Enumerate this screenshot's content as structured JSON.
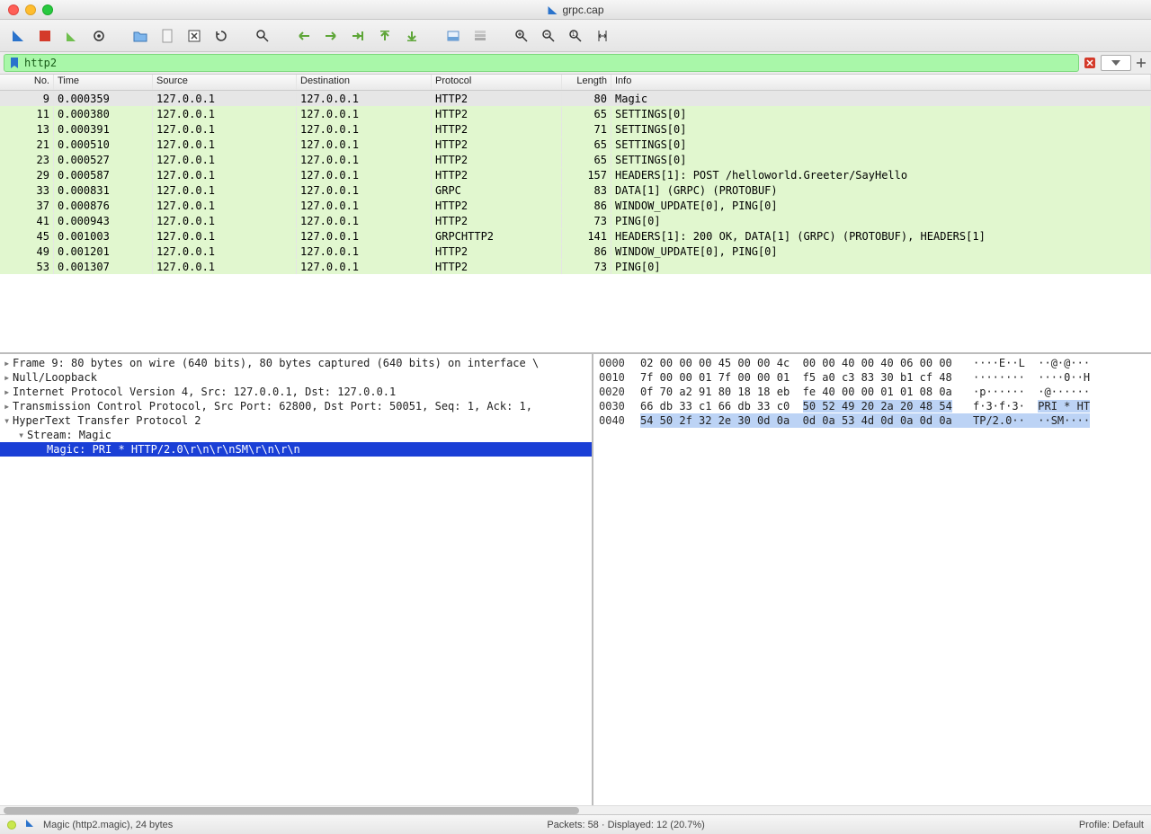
{
  "title": "grpc.cap",
  "filter": "http2",
  "columns": [
    "No.",
    "Time",
    "Source",
    "Destination",
    "Protocol",
    "Length",
    "Info"
  ],
  "packets": [
    {
      "no": "9",
      "time": "0.000359",
      "src": "127.0.0.1",
      "dst": "127.0.0.1",
      "proto": "HTTP2",
      "len": "80",
      "info": "Magic",
      "sel": true
    },
    {
      "no": "11",
      "time": "0.000380",
      "src": "127.0.0.1",
      "dst": "127.0.0.1",
      "proto": "HTTP2",
      "len": "65",
      "info": "SETTINGS[0]"
    },
    {
      "no": "13",
      "time": "0.000391",
      "src": "127.0.0.1",
      "dst": "127.0.0.1",
      "proto": "HTTP2",
      "len": "71",
      "info": "SETTINGS[0]"
    },
    {
      "no": "21",
      "time": "0.000510",
      "src": "127.0.0.1",
      "dst": "127.0.0.1",
      "proto": "HTTP2",
      "len": "65",
      "info": "SETTINGS[0]"
    },
    {
      "no": "23",
      "time": "0.000527",
      "src": "127.0.0.1",
      "dst": "127.0.0.1",
      "proto": "HTTP2",
      "len": "65",
      "info": "SETTINGS[0]"
    },
    {
      "no": "29",
      "time": "0.000587",
      "src": "127.0.0.1",
      "dst": "127.0.0.1",
      "proto": "HTTP2",
      "len": "157",
      "info": "HEADERS[1]: POST /helloworld.Greeter/SayHello"
    },
    {
      "no": "33",
      "time": "0.000831",
      "src": "127.0.0.1",
      "dst": "127.0.0.1",
      "proto": "GRPC",
      "len": "83",
      "info": "DATA[1] (GRPC) (PROTOBUF)"
    },
    {
      "no": "37",
      "time": "0.000876",
      "src": "127.0.0.1",
      "dst": "127.0.0.1",
      "proto": "HTTP2",
      "len": "86",
      "info": "WINDOW_UPDATE[0], PING[0]"
    },
    {
      "no": "41",
      "time": "0.000943",
      "src": "127.0.0.1",
      "dst": "127.0.0.1",
      "proto": "HTTP2",
      "len": "73",
      "info": "PING[0]"
    },
    {
      "no": "45",
      "time": "0.001003",
      "src": "127.0.0.1",
      "dst": "127.0.0.1",
      "proto": "GRPCHTTP2",
      "len": "141",
      "info": "HEADERS[1]: 200 OK, DATA[1] (GRPC) (PROTOBUF), HEADERS[1]"
    },
    {
      "no": "49",
      "time": "0.001201",
      "src": "127.0.0.1",
      "dst": "127.0.0.1",
      "proto": "HTTP2",
      "len": "86",
      "info": "WINDOW_UPDATE[0], PING[0]"
    },
    {
      "no": "53",
      "time": "0.001307",
      "src": "127.0.0.1",
      "dst": "127.0.0.1",
      "proto": "HTTP2",
      "len": "73",
      "info": "PING[0]"
    }
  ],
  "tree": {
    "l0": "Frame 9: 80 bytes on wire (640 bits), 80 bytes captured (640 bits) on interface \\",
    "l1": "Null/Loopback",
    "l2": "Internet Protocol Version 4, Src: 127.0.0.1, Dst: 127.0.0.1",
    "l3": "Transmission Control Protocol, Src Port: 62800, Dst Port: 50051, Seq: 1, Ack: 1,",
    "l4": "HyperText Transfer Protocol 2",
    "l5": "Stream: Magic",
    "l6": "Magic: PRI * HTTP/2.0\\r\\n\\r\\nSM\\r\\n\\r\\n"
  },
  "hex": {
    "r0off": "0000",
    "r0b": "02 00 00 00 45 00 00 4c  00 00 40 00 40 06 00 00",
    "r0a": "····E··L  ··@·@···",
    "r1off": "0010",
    "r1b": "7f 00 00 01 7f 00 00 01  f5 a0 c3 83 30 b1 cf 48",
    "r1a": "········  ····0··H",
    "r2off": "0020",
    "r2b": "0f 70 a2 91 80 18 18 eb  fe 40 00 00 01 01 08 0a",
    "r2a": "·p······  ·@······",
    "r3off": "0030",
    "r3b": "66 db 33 c1 66 db 33 c0  ",
    "r3b2": "50 52 49 20 2a 20 48 54",
    "r3a": "f·3·f·3·  ",
    "r3a2": "PRI * HT",
    "r4off": "0040",
    "r4b": "54 50 2f 32 2e 30 0d 0a  0d 0a 53 4d 0d 0a 0d 0a",
    "r4a": "TP/2.0··  ··SM····"
  },
  "status": {
    "left": "Magic (http2.magic), 24 bytes",
    "mid": "Packets: 58 · Displayed: 12 (20.7%)",
    "right": "Profile: Default"
  }
}
